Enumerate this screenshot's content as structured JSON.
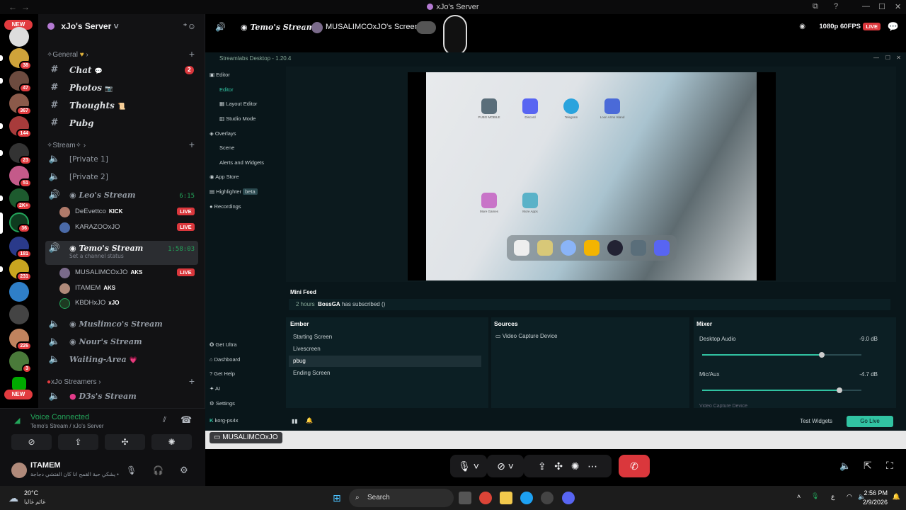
{
  "window": {
    "title": "xJo's Server"
  },
  "rail": {
    "new_label_top": "NEW",
    "new_label_bottom": "NEW",
    "badges": [
      "38",
      "47",
      "367",
      "144",
      "23",
      "51",
      "2K+",
      "36",
      "181",
      "231",
      "226",
      "3"
    ]
  },
  "sidebar": {
    "server_name": "xJo's Server",
    "categories": {
      "general": "General",
      "stream": "Stream",
      "xjo_streamers": "xJo Streamers"
    },
    "text_channels": [
      {
        "label": "Chat",
        "unread": "2"
      },
      {
        "label": "Photos"
      },
      {
        "label": "Thoughts"
      },
      {
        "label": "Pubg"
      }
    ],
    "voice_channels": [
      {
        "label": "[Private 1]"
      },
      {
        "label": "[Private 2]"
      },
      {
        "label": "Leo's Stream",
        "timer": "6:15"
      },
      {
        "label": "Temo's Stream",
        "timer": "1:58:03",
        "status": "Set a channel status"
      },
      {
        "label": "Muslimco's Stream"
      },
      {
        "label": "Nour's Stream"
      },
      {
        "label": "Waiting-Area"
      },
      {
        "label": "D3s's Stream"
      }
    ],
    "leo_users": [
      {
        "name": "DeEvettco",
        "tag": "KICK",
        "live": "LIVE"
      },
      {
        "name": "KARAZOOxJO",
        "live": "LIVE"
      }
    ],
    "temo_users": [
      {
        "name": "MUSALIMCOxJO",
        "tag": "AKS",
        "live": "LIVE"
      },
      {
        "name": "ITAMEM",
        "tag": "AKS"
      },
      {
        "name": "KBDHxJO",
        "tag": "xJO"
      }
    ]
  },
  "voice_panel": {
    "status": "Voice Connected",
    "location": "Temo's Stream / xJo's Server",
    "username": "ITAMEM",
    "user_status": "يشكي حبة القمح انا كان الفتشي دجاجة •"
  },
  "stream_header": {
    "channel": "Temo's Stream",
    "screen_owner": "MUSALIMCOxJO's Screen",
    "quality": "1080p 60FPS",
    "live": "LIVE"
  },
  "streamlabs": {
    "title": "Streamlabs Desktop - 1.20.4",
    "nav": {
      "editor": "Editor",
      "editor_sub": "Editor",
      "layout_editor": "Layout Editor",
      "studio_mode": "Studio Mode",
      "overlays": "Overlays",
      "scene": "Scene",
      "alerts": "Alerts and Widgets",
      "app_store": "App Store",
      "highlighter": "Highlighter",
      "beta": "beta",
      "recordings": "Recordings",
      "get_ultra": "Get Ultra",
      "dashboard": "Dashboard",
      "get_help": "Get Help",
      "ai": "AI",
      "settings": "Settings",
      "account": "korg-ps4x"
    },
    "apps": [
      {
        "label": "PUBG MOBILE"
      },
      {
        "label": "Discord"
      },
      {
        "label": "Telegram"
      },
      {
        "label": "Loon Arms Island"
      },
      {
        "label": "More Games"
      },
      {
        "label": "More Apps"
      }
    ],
    "mini_feed": {
      "title": "Mini Feed",
      "time": "2 hours",
      "user": "BossGA",
      "event": "has subscribed ()"
    },
    "scenes": {
      "title": "Ember",
      "items": [
        "Starting Screen",
        "Livescreen",
        "pbug",
        "Ending Screen"
      ],
      "selected_index": 2
    },
    "sources": {
      "title": "Sources",
      "items": [
        "Video Capture Device"
      ]
    },
    "mixer": {
      "title": "Mixer",
      "channels": [
        {
          "name": "Desktop Audio",
          "db": "-9.0 dB",
          "level": 0.75
        },
        {
          "name": "Mic/Aux",
          "db": "-4.7 dB",
          "level": 0.86
        }
      ],
      "partial": "Video Capture Device"
    },
    "footer": {
      "test_widgets": "Test Widgets",
      "go_live": "Go Live"
    }
  },
  "stream_owner_tag": "MUSALIMCOxJO",
  "taskbar": {
    "weather_temp": "20°C",
    "weather_desc": "غائم غالبا",
    "search": "Search",
    "time": "2:56 PM",
    "date": "2/9/2026",
    "lang": "ع"
  }
}
